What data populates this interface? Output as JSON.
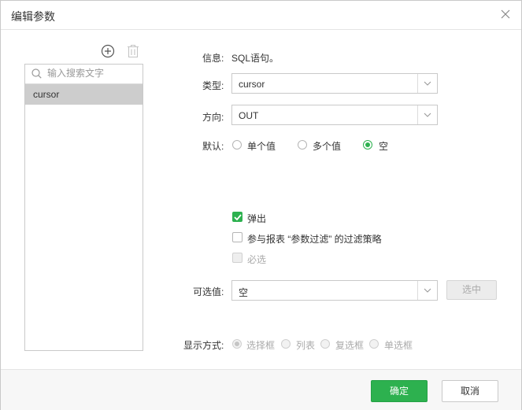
{
  "dialog": {
    "title": "编辑参数"
  },
  "left_panel": {
    "search_placeholder": "输入搜索文字",
    "items": [
      {
        "label": "cursor",
        "selected": true
      }
    ]
  },
  "form": {
    "info_label": "信息:",
    "info_value": "SQL语句。",
    "type_label": "类型:",
    "type_value": "cursor",
    "direction_label": "方向:",
    "direction_value": "OUT",
    "default_label": "默认:",
    "default_options": [
      "单个值",
      "多个值",
      "空"
    ],
    "default_selected": "空",
    "popup_label": "弹出",
    "popup_checked": true,
    "filter_label": "参与报表 “参数过滤” 的过滤策略",
    "filter_checked": false,
    "required_label": "必选",
    "required_checked": false,
    "required_disabled": true,
    "options_label": "可选值:",
    "options_value": "空",
    "select_button": "选中",
    "display_label": "显示方式:",
    "display_options": [
      "选择框",
      "列表",
      "复选框",
      "单选框"
    ],
    "display_selected": "选择框"
  },
  "footer": {
    "ok": "确定",
    "cancel": "取消"
  },
  "colors": {
    "accent": "#2db14f",
    "selected_row": "#cdcdcd",
    "border": "#c9c9c9"
  }
}
